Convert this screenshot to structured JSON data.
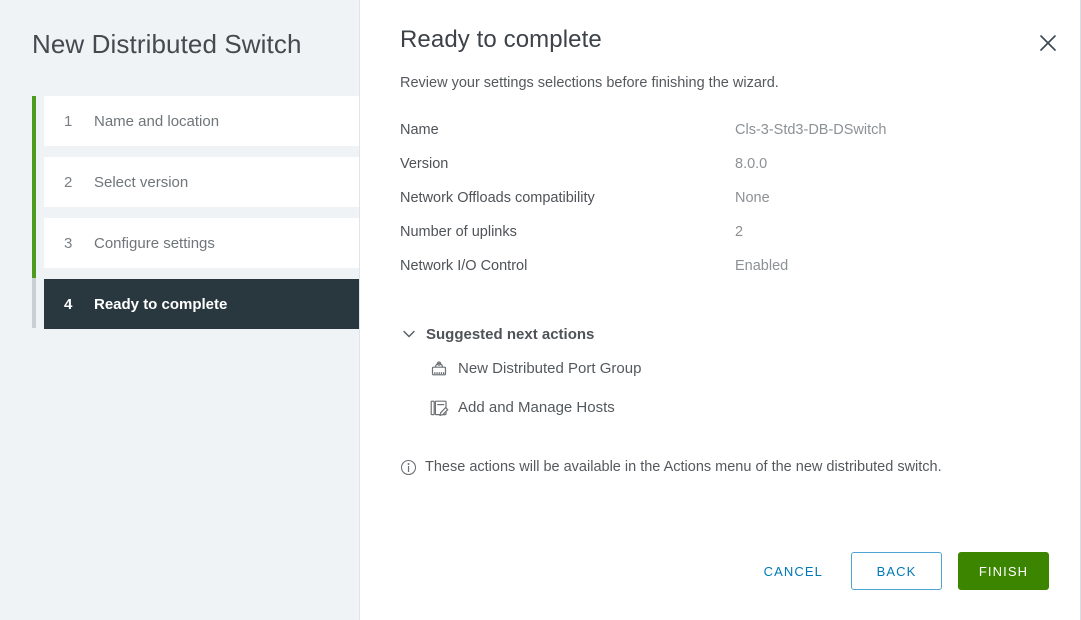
{
  "sidebar": {
    "title": "New Distributed Switch",
    "steps": [
      {
        "num": "1",
        "label": "Name and location",
        "active": false
      },
      {
        "num": "2",
        "label": "Select version",
        "active": false
      },
      {
        "num": "3",
        "label": "Configure settings",
        "active": false
      },
      {
        "num": "4",
        "label": "Ready to complete",
        "active": true
      }
    ]
  },
  "panel": {
    "title": "Ready to complete",
    "subtitle": "Review your settings selections before finishing the wizard.",
    "close_icon": "close-icon"
  },
  "summary": [
    {
      "key": "Name",
      "value": "Cls-3-Std3-DB-DSwitch"
    },
    {
      "key": "Version",
      "value": "8.0.0"
    },
    {
      "key": "Network Offloads compatibility",
      "value": "None"
    },
    {
      "key": "Number of uplinks",
      "value": "2"
    },
    {
      "key": "Network I/O Control",
      "value": "Enabled"
    }
  ],
  "suggested": {
    "heading": "Suggested next actions",
    "chevron_icon": "chevron-down-icon",
    "actions": [
      {
        "label": "New Distributed Port Group",
        "icon": "port-group-icon"
      },
      {
        "label": "Add and Manage Hosts",
        "icon": "add-manage-hosts-icon"
      }
    ]
  },
  "note": {
    "icon": "info-icon",
    "text": "These actions will be available in the Actions menu of the new distributed switch."
  },
  "footer": {
    "cancel_label": "CANCEL",
    "back_label": "BACK",
    "finish_label": "FINISH"
  },
  "colors": {
    "accent_blue": "#0079b8",
    "finish_green": "#3c8500",
    "progress_green": "#4d9c1f",
    "active_step_bg": "#29373f",
    "sidebar_bg": "#eff3f6"
  }
}
